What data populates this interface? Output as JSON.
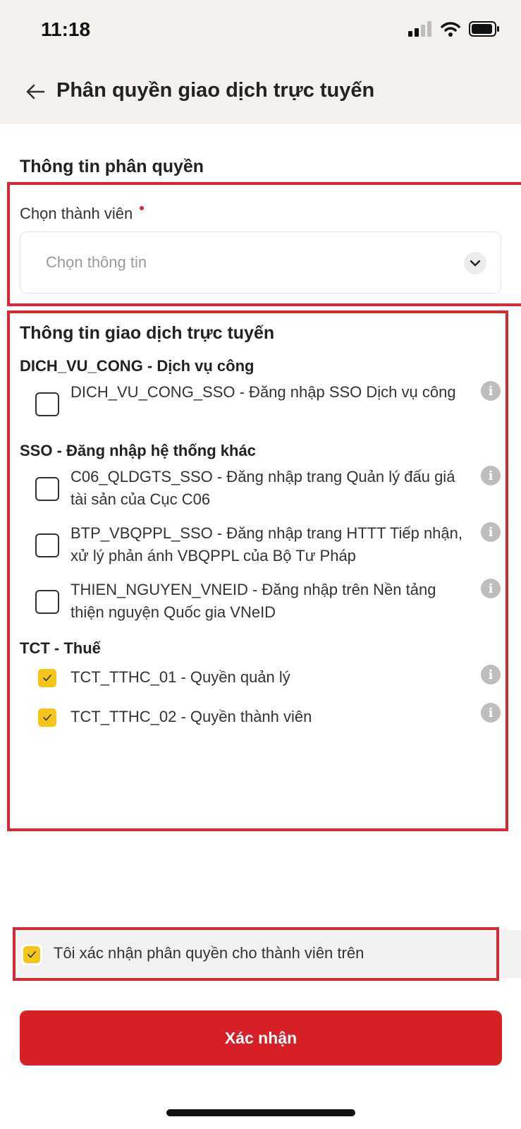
{
  "status_bar": {
    "time": "11:18"
  },
  "header": {
    "title": "Phân quyền giao dịch trực tuyến"
  },
  "permission_info": {
    "title": "Thông tin phân quyền",
    "member_label": "Chọn thành viên",
    "member_placeholder": "Chọn thông tin"
  },
  "transactions": {
    "title": "Thông tin giao dịch trực tuyến",
    "groups": [
      {
        "title": "DICH_VU_CONG - Dịch vụ công",
        "items": [
          {
            "label": "DICH_VU_CONG_SSO - Đăng nhập SSO Dịch vụ công",
            "checked": false
          }
        ]
      },
      {
        "title": "SSO - Đăng nhập hệ thống khác",
        "items": [
          {
            "label": "C06_QLDGTS_SSO - Đăng nhập trang Quản lý đấu giá tài sản của Cục C06",
            "checked": false
          },
          {
            "label": "BTP_VBQPPL_SSO - Đăng nhập trang HTTT Tiếp nhận, xử lý phản ánh VBQPPL của Bộ Tư Pháp",
            "checked": false
          },
          {
            "label": "THIEN_NGUYEN_VNEID - Đăng nhập trên Nền tảng thiện nguyện Quốc gia VNeID",
            "checked": false
          }
        ]
      },
      {
        "title": "TCT - Thuế",
        "items": [
          {
            "label": "TCT_TTHC_01 - Quyền quản lý",
            "checked": true
          },
          {
            "label": "TCT_TTHC_02 - Quyền thành viên",
            "checked": true
          }
        ]
      }
    ]
  },
  "confirm": {
    "text": "Tôi xác nhận phân quyền cho thành viên trên",
    "checked": true
  },
  "submit": {
    "label": "Xác nhận"
  },
  "colors": {
    "accent": "#d71f26",
    "checkbox_checked": "#f5c518",
    "highlight_border": "#d42a35",
    "header_bg": "#f4f1ec"
  },
  "icons": [
    "signal-icon",
    "wifi-icon",
    "battery-icon",
    "back-arrow-icon",
    "chevron-down-icon",
    "info-icon",
    "check-icon"
  ]
}
